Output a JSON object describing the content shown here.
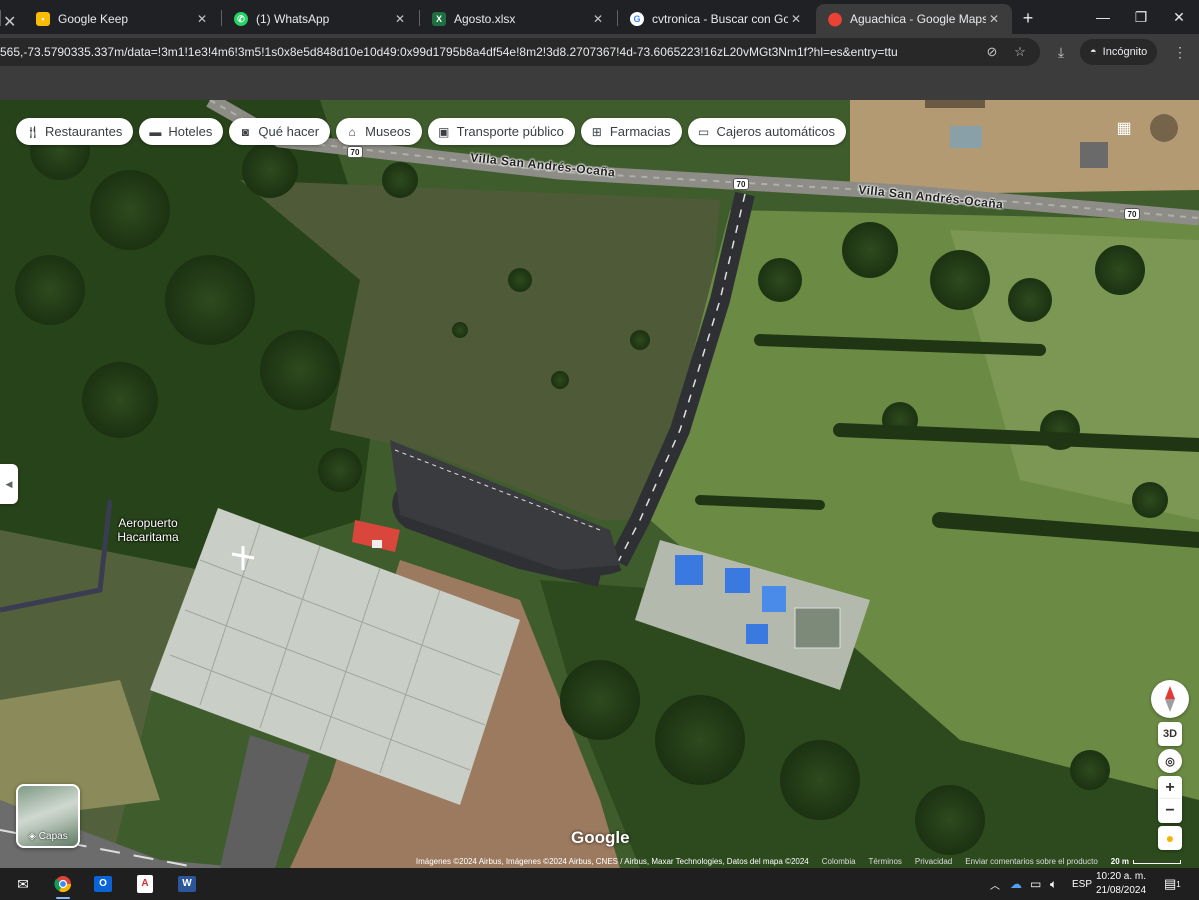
{
  "tabs": [
    {
      "title": "Google Keep",
      "icon": "keep-icon",
      "color": "#fbbc04"
    },
    {
      "title": "(1) WhatsApp",
      "icon": "whatsapp-icon",
      "color": "#25d366"
    },
    {
      "title": "Agosto.xlsx",
      "icon": "excel-icon",
      "color": "#1d6f42"
    },
    {
      "title": "cvtronica - Buscar con Google",
      "icon": "google-icon",
      "color": "#ffffff"
    },
    {
      "title": "Aguachica - Google Maps",
      "icon": "maps-icon",
      "color": "#34a853"
    }
  ],
  "address_bar": {
    "url": "565,-73.5790335.337m/data=!3m1!1e3!4m6!3m5!1s0x8e5d848d10e10d49:0x99d1795b8a4df54e!8m2!3d8.2707367!4d-73.6065223!16zL20vMGt3Nm1f?hl=es&entry=ttu",
    "incognito_label": "Incógnito"
  },
  "map": {
    "chips": [
      {
        "label": "Restaurantes",
        "icon": "fork-knife-icon"
      },
      {
        "label": "Hoteles",
        "icon": "bed-icon"
      },
      {
        "label": "Qué hacer",
        "icon": "camera-icon"
      },
      {
        "label": "Museos",
        "icon": "museum-icon"
      },
      {
        "label": "Transporte público",
        "icon": "bus-icon"
      },
      {
        "label": "Farmacias",
        "icon": "pharmacy-icon"
      },
      {
        "label": "Cajeros automáticos",
        "icon": "atm-icon"
      }
    ],
    "place_label": "Aeropuerto\nHacaritama",
    "road_labels": [
      "Villa San Andrés-Ocaña",
      "Villa San Andrés-Ocaña"
    ],
    "road_shield": "70",
    "layers_label": "Capas",
    "logo": "Google",
    "controls": {
      "three_d": "3D",
      "zoom_in": "+",
      "zoom_out": "−"
    },
    "attribution": {
      "imagery": "Imágenes ©2024 Airbus, Imágenes ©2024 Airbus, CNES / Airbus, Maxar Technologies, Datos del mapa ©2024",
      "country": "Colombia",
      "terms": "Términos",
      "privacy": "Privacidad",
      "feedback": "Enviar comentarios sobre el producto",
      "scale": "20 m"
    }
  },
  "taskbar": {
    "language": "ESP",
    "time": "10:20 a. m.",
    "date": "21/08/2024",
    "notification_count": "1"
  }
}
